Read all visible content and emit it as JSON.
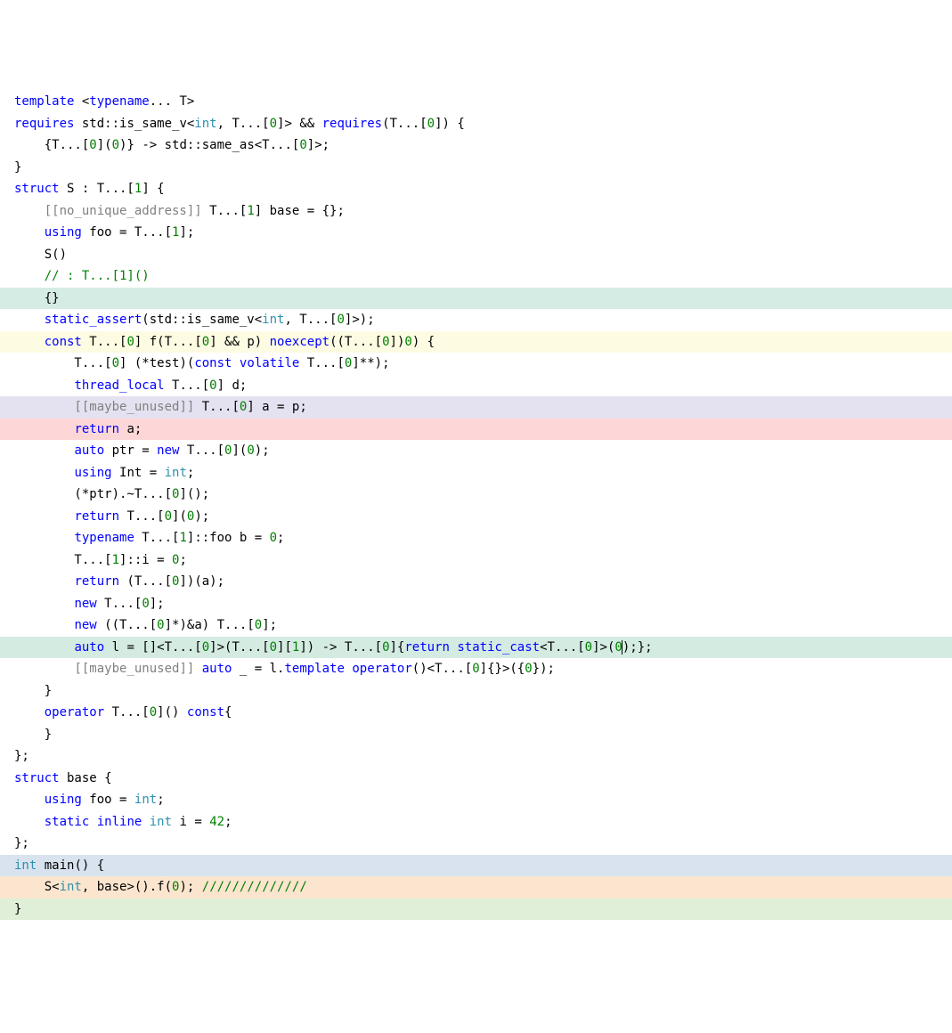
{
  "lines": [
    {
      "bg": "",
      "tokens": [
        [
          "kw",
          "template"
        ],
        [
          "op",
          " <"
        ],
        [
          "kw",
          "typename"
        ],
        [
          "op",
          "... T>"
        ]
      ]
    },
    {
      "bg": "",
      "tokens": [
        [
          "kw",
          "requires"
        ],
        [
          "op",
          " std::is_same_v<"
        ],
        [
          "type",
          "int"
        ],
        [
          "op",
          ", T...["
        ],
        [
          "num",
          "0"
        ],
        [
          "op",
          "]> && "
        ],
        [
          "kw",
          "requires"
        ],
        [
          "op",
          "(T...["
        ],
        [
          "num",
          "0"
        ],
        [
          "op",
          "]) {"
        ]
      ]
    },
    {
      "bg": "",
      "tokens": [
        [
          "op",
          "    {T...["
        ],
        [
          "num",
          "0"
        ],
        [
          "op",
          "]("
        ],
        [
          "num",
          "0"
        ],
        [
          "op",
          ")} -> std::same_as<T...["
        ],
        [
          "num",
          "0"
        ],
        [
          "op",
          "]>;"
        ]
      ]
    },
    {
      "bg": "",
      "tokens": [
        [
          "op",
          "}"
        ]
      ]
    },
    {
      "bg": "",
      "tokens": [
        [
          "kw",
          "struct"
        ],
        [
          "op",
          " S : T...["
        ],
        [
          "num",
          "1"
        ],
        [
          "op",
          "] {"
        ]
      ]
    },
    {
      "bg": "",
      "tokens": [
        [
          "op",
          "    "
        ],
        [
          "attr",
          "[[no_unique_address]]"
        ],
        [
          "op",
          " T...["
        ],
        [
          "num",
          "1"
        ],
        [
          "op",
          "] base = {};"
        ]
      ]
    },
    {
      "bg": "",
      "tokens": [
        [
          "op",
          "    "
        ],
        [
          "kw",
          "using"
        ],
        [
          "op",
          " foo = T...["
        ],
        [
          "num",
          "1"
        ],
        [
          "op",
          "];"
        ]
      ]
    },
    {
      "bg": "",
      "tokens": [
        [
          "op",
          "    S()"
        ]
      ]
    },
    {
      "bg": "",
      "tokens": [
        [
          "op",
          "    "
        ],
        [
          "cmt",
          "// : T...[1]()"
        ]
      ]
    },
    {
      "bg": "bg-teal",
      "tokens": [
        [
          "op",
          "    {}"
        ]
      ]
    },
    {
      "bg": "",
      "tokens": [
        [
          "op",
          "    "
        ],
        [
          "kw",
          "static_assert"
        ],
        [
          "op",
          "(std::is_same_v<"
        ],
        [
          "type",
          "int"
        ],
        [
          "op",
          ", T...["
        ],
        [
          "num",
          "0"
        ],
        [
          "op",
          "]>);"
        ]
      ]
    },
    {
      "bg": "bg-yellow",
      "tokens": [
        [
          "op",
          "    "
        ],
        [
          "kw",
          "const"
        ],
        [
          "op",
          " T...["
        ],
        [
          "num",
          "0"
        ],
        [
          "op",
          "] f(T...["
        ],
        [
          "num",
          "0"
        ],
        [
          "op",
          "] && p) "
        ],
        [
          "kw",
          "noexcept"
        ],
        [
          "op",
          "((T...["
        ],
        [
          "num",
          "0"
        ],
        [
          "op",
          "])"
        ],
        [
          "num",
          "0"
        ],
        [
          "op",
          ") {"
        ]
      ]
    },
    {
      "bg": "",
      "tokens": [
        [
          "op",
          "        T...["
        ],
        [
          "num",
          "0"
        ],
        [
          "op",
          "] (*test)("
        ],
        [
          "kw",
          "const"
        ],
        [
          "op",
          " "
        ],
        [
          "kw",
          "volatile"
        ],
        [
          "op",
          " T...["
        ],
        [
          "num",
          "0"
        ],
        [
          "op",
          "]**);"
        ]
      ]
    },
    {
      "bg": "",
      "tokens": [
        [
          "op",
          "        "
        ],
        [
          "kw",
          "thread_local"
        ],
        [
          "op",
          " T...["
        ],
        [
          "num",
          "0"
        ],
        [
          "op",
          "] d;"
        ]
      ]
    },
    {
      "bg": "bg-lav",
      "tokens": [
        [
          "op",
          "        "
        ],
        [
          "attr",
          "[[maybe_unused]]"
        ],
        [
          "op",
          " T...["
        ],
        [
          "num",
          "0"
        ],
        [
          "op",
          "] a = p;"
        ]
      ]
    },
    {
      "bg": "bg-red",
      "tokens": [
        [
          "op",
          "        "
        ],
        [
          "kw",
          "return"
        ],
        [
          "op",
          " a;"
        ]
      ]
    },
    {
      "bg": "",
      "tokens": [
        [
          "op",
          "        "
        ],
        [
          "kw",
          "auto"
        ],
        [
          "op",
          " ptr = "
        ],
        [
          "kw",
          "new"
        ],
        [
          "op",
          " T...["
        ],
        [
          "num",
          "0"
        ],
        [
          "op",
          "]("
        ],
        [
          "num",
          "0"
        ],
        [
          "op",
          ");"
        ]
      ]
    },
    {
      "bg": "",
      "tokens": [
        [
          "op",
          "        "
        ],
        [
          "kw",
          "using"
        ],
        [
          "op",
          " Int = "
        ],
        [
          "type",
          "int"
        ],
        [
          "op",
          ";"
        ]
      ]
    },
    {
      "bg": "",
      "tokens": [
        [
          "op",
          "        (*ptr).~T...["
        ],
        [
          "num",
          "0"
        ],
        [
          "op",
          "]();"
        ]
      ]
    },
    {
      "bg": "",
      "tokens": [
        [
          "op",
          "        "
        ],
        [
          "kw",
          "return"
        ],
        [
          "op",
          " T...["
        ],
        [
          "num",
          "0"
        ],
        [
          "op",
          "]("
        ],
        [
          "num",
          "0"
        ],
        [
          "op",
          ");"
        ]
      ]
    },
    {
      "bg": "",
      "tokens": [
        [
          "op",
          "        "
        ],
        [
          "kw",
          "typename"
        ],
        [
          "op",
          " T...["
        ],
        [
          "num",
          "1"
        ],
        [
          "op",
          "]::foo b = "
        ],
        [
          "num",
          "0"
        ],
        [
          "op",
          ";"
        ]
      ]
    },
    {
      "bg": "",
      "tokens": [
        [
          "op",
          "        T...["
        ],
        [
          "num",
          "1"
        ],
        [
          "op",
          "]::i = "
        ],
        [
          "num",
          "0"
        ],
        [
          "op",
          ";"
        ]
      ]
    },
    {
      "bg": "",
      "tokens": [
        [
          "op",
          "        "
        ],
        [
          "kw",
          "return"
        ],
        [
          "op",
          " (T...["
        ],
        [
          "num",
          "0"
        ],
        [
          "op",
          "])(a);"
        ]
      ]
    },
    {
      "bg": "",
      "tokens": [
        [
          "op",
          "        "
        ],
        [
          "kw",
          "new"
        ],
        [
          "op",
          " T...["
        ],
        [
          "num",
          "0"
        ],
        [
          "op",
          "];"
        ]
      ]
    },
    {
      "bg": "",
      "tokens": [
        [
          "op",
          "        "
        ],
        [
          "kw",
          "new"
        ],
        [
          "op",
          " ((T...["
        ],
        [
          "num",
          "0"
        ],
        [
          "op",
          "]*)&a) T...["
        ],
        [
          "num",
          "0"
        ],
        [
          "op",
          "];"
        ]
      ]
    },
    {
      "bg": "bg-teal2",
      "cursor": true,
      "tokens": [
        [
          "op",
          "        "
        ],
        [
          "kw",
          "auto"
        ],
        [
          "op",
          " l = []<T...["
        ],
        [
          "num",
          "0"
        ],
        [
          "op",
          "]>(T...["
        ],
        [
          "num",
          "0"
        ],
        [
          "op",
          "]["
        ],
        [
          "num",
          "1"
        ],
        [
          "op",
          "]) -> T...["
        ],
        [
          "num",
          "0"
        ],
        [
          "op",
          "]{"
        ],
        [
          "kw",
          "return"
        ],
        [
          "op",
          " "
        ],
        [
          "kw",
          "static_cast"
        ],
        [
          "op",
          "<T...["
        ],
        [
          "num",
          "0"
        ],
        [
          "op",
          "]>("
        ],
        [
          "num",
          "0"
        ],
        [
          "op",
          ");};"
        ]
      ]
    },
    {
      "bg": "",
      "tokens": [
        [
          "op",
          "        "
        ],
        [
          "attr",
          "[[maybe_unused]]"
        ],
        [
          "op",
          " "
        ],
        [
          "kw",
          "auto"
        ],
        [
          "op",
          " _ = l."
        ],
        [
          "kw",
          "template"
        ],
        [
          "op",
          " "
        ],
        [
          "kw",
          "operator"
        ],
        [
          "op",
          "()<T...["
        ],
        [
          "num",
          "0"
        ],
        [
          "op",
          "]{}>({"
        ],
        [
          "num",
          "0"
        ],
        [
          "op",
          "});"
        ]
      ]
    },
    {
      "bg": "",
      "tokens": [
        [
          "op",
          "    }"
        ]
      ]
    },
    {
      "bg": "",
      "tokens": [
        [
          "op",
          "    "
        ],
        [
          "kw",
          "operator"
        ],
        [
          "op",
          " T...["
        ],
        [
          "num",
          "0"
        ],
        [
          "op",
          "]() "
        ],
        [
          "kw",
          "const"
        ],
        [
          "op",
          "{"
        ]
      ]
    },
    {
      "bg": "",
      "tokens": [
        [
          "op",
          "    }"
        ]
      ]
    },
    {
      "bg": "",
      "tokens": [
        [
          "op",
          "};"
        ]
      ]
    },
    {
      "bg": "",
      "tokens": [
        [
          "op",
          ""
        ]
      ]
    },
    {
      "bg": "",
      "tokens": [
        [
          "kw",
          "struct"
        ],
        [
          "op",
          " base {"
        ]
      ]
    },
    {
      "bg": "",
      "tokens": [
        [
          "op",
          "    "
        ],
        [
          "kw",
          "using"
        ],
        [
          "op",
          " foo = "
        ],
        [
          "type",
          "int"
        ],
        [
          "op",
          ";"
        ]
      ]
    },
    {
      "bg": "",
      "tokens": [
        [
          "op",
          "    "
        ],
        [
          "kw",
          "static"
        ],
        [
          "op",
          " "
        ],
        [
          "kw",
          "inline"
        ],
        [
          "op",
          " "
        ],
        [
          "type",
          "int"
        ],
        [
          "op",
          " i = "
        ],
        [
          "num",
          "42"
        ],
        [
          "op",
          ";"
        ]
      ]
    },
    {
      "bg": "",
      "tokens": [
        [
          "op",
          "};"
        ]
      ]
    },
    {
      "bg": "",
      "tokens": [
        [
          "op",
          ""
        ]
      ]
    },
    {
      "bg": "bg-blue",
      "tokens": [
        [
          "type",
          "int"
        ],
        [
          "op",
          " main() {"
        ]
      ]
    },
    {
      "bg": "bg-orange",
      "tokens": [
        [
          "op",
          "    S<"
        ],
        [
          "type",
          "int"
        ],
        [
          "op",
          ", base>().f("
        ],
        [
          "num",
          "0"
        ],
        [
          "op",
          "); "
        ],
        [
          "cmt",
          "//////////////"
        ]
      ]
    },
    {
      "bg": "bg-green",
      "tokens": [
        [
          "op",
          "}"
        ]
      ]
    }
  ]
}
